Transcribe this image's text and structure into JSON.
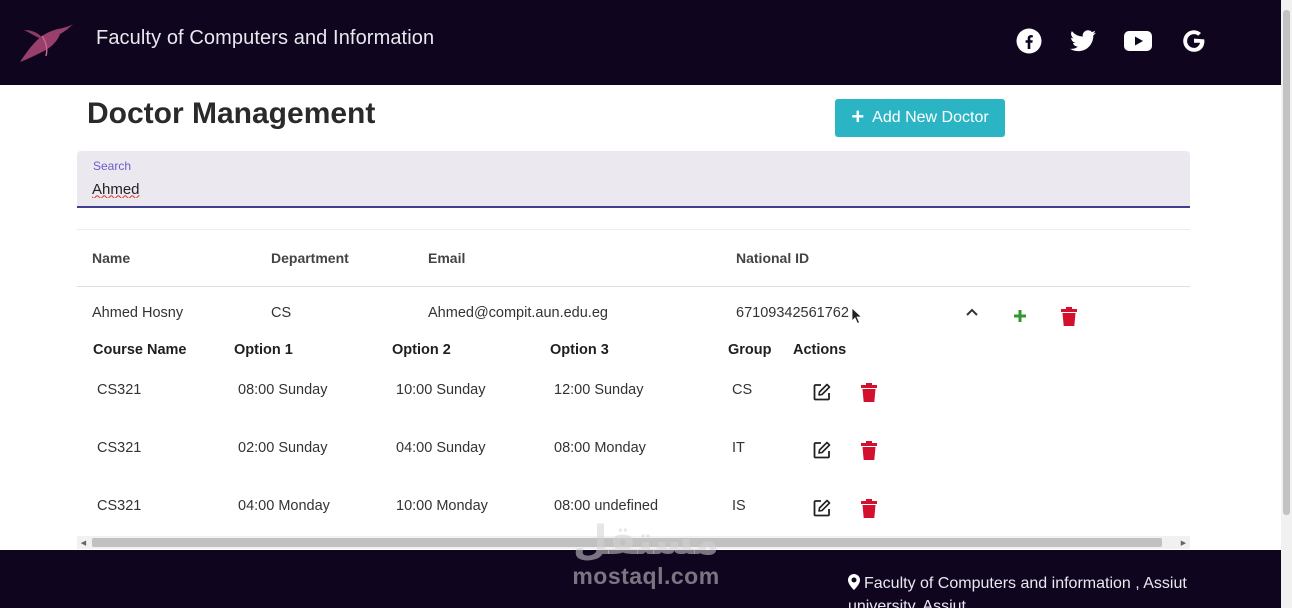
{
  "header": {
    "site_title": "Faculty of Computers and Information",
    "social": [
      "facebook-icon",
      "twitter-icon",
      "youtube-icon",
      "google-icon"
    ]
  },
  "page": {
    "title": "Doctor Management",
    "add_button_label": "Add New Doctor"
  },
  "search": {
    "label": "Search",
    "value": "Ahmed"
  },
  "table": {
    "columns": [
      "Name",
      "Department",
      "Email",
      "National ID"
    ],
    "rows": [
      {
        "name": "Ahmed Hosny",
        "department": "CS",
        "email": "Ahmed@compit.aun.edu.eg",
        "national_id": "67109342561762"
      }
    ]
  },
  "courses": {
    "columns": [
      "Course Name",
      "Option 1",
      "Option 2",
      "Option 3",
      "Group",
      "Actions"
    ],
    "rows": [
      {
        "course": "CS321",
        "option1": "08:00 Sunday",
        "option2": "10:00 Sunday",
        "option3": "12:00 Sunday",
        "group": "CS"
      },
      {
        "course": "CS321",
        "option1": "02:00 Sunday",
        "option2": "04:00 Sunday",
        "option3": "08:00 Monday",
        "group": "IT"
      },
      {
        "course": "CS321",
        "option1": "04:00 Monday",
        "option2": "10:00 Monday",
        "option3": "08:00 undefined",
        "group": "IS"
      }
    ]
  },
  "footer": {
    "address": "Faculty of Computers and information , Assiut university, Assiut"
  },
  "watermark": {
    "arabic": "مستقل",
    "latin": "mostaql.com"
  },
  "colors": {
    "header_bg": "#10051f",
    "accent": "#2bb4c4",
    "delete": "#d3112e",
    "add": "#2e9a2e"
  }
}
